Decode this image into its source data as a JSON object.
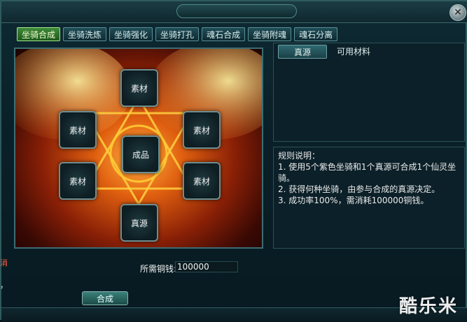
{
  "window": {
    "close_glyph": "✕"
  },
  "tabs": [
    {
      "label": "坐骑合成",
      "active": true
    },
    {
      "label": "坐骑洗炼",
      "active": false
    },
    {
      "label": "坐骑强化",
      "active": false
    },
    {
      "label": "坐骑打孔",
      "active": false
    },
    {
      "label": "魂石合成",
      "active": false
    },
    {
      "label": "坐骑附魂",
      "active": false
    },
    {
      "label": "魂石分离",
      "active": false
    }
  ],
  "slots": {
    "top": "素材",
    "upper_left": "素材",
    "upper_right": "素材",
    "center": "成品",
    "lower_left": "素材",
    "lower_right": "素材",
    "bottom": "真源"
  },
  "cost": {
    "label": "所需铜钱:",
    "value": "100000"
  },
  "combine_button": "合成",
  "right_panel": {
    "subtabs": [
      {
        "label": "真源",
        "active": true
      },
      {
        "label": "可用材料",
        "active": false
      }
    ]
  },
  "rules": {
    "title": "规则说明：",
    "lines": [
      "1. 使用5个紫色坐骑和1个真源可合成1个仙灵坐骑。",
      "2. 获得何种坐骑，由参与合成的真源决定。",
      "3. 成功率100%，需消耗100000铜钱。"
    ]
  },
  "left_edge": {
    "line1": "消",
    "line2": "，"
  },
  "watermark": "酷乐米",
  "colors": {
    "accent_active_tab": "#3e8a3a",
    "frame": "#2f5a5e",
    "stage_glow": "#e06010"
  }
}
